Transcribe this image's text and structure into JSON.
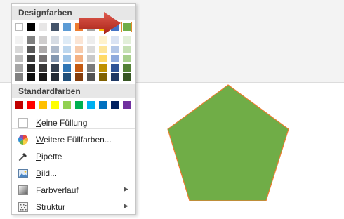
{
  "menu": {
    "design_header": "Designfarben",
    "standard_header": "Standardfarben",
    "items": [
      {
        "label": "Keine Füllung",
        "mnemonic": "K",
        "rest": "eine Füllung",
        "icon": "no-fill-swatch-icon"
      },
      {
        "label": "Weitere Füllfarben...",
        "mnemonic": "W",
        "rest": "eitere Füllfarben...",
        "icon": "color-wheel-icon"
      },
      {
        "label": "Pipette",
        "mnemonic": "P",
        "rest": "ipette",
        "icon": "eyedropper-icon"
      },
      {
        "label": "Bild...",
        "mnemonic": "B",
        "rest": "ild...",
        "icon": "picture-icon"
      },
      {
        "label": "Farbverlauf",
        "mnemonic": "F",
        "rest": "arbverlauf",
        "icon": "gradient-icon",
        "submenu": true
      },
      {
        "label": "Struktur",
        "mnemonic": "S",
        "rest": "truktur",
        "icon": "texture-icon",
        "submenu": true
      }
    ],
    "theme_colors": [
      "#ffffff",
      "#000000",
      "#e7e6e6",
      "#44546a",
      "#5b9bd5",
      "#ed7d31",
      "#a5a5a5",
      "#ffc000",
      "#4472c4",
      "#70ad47"
    ],
    "theme_shades": [
      [
        "#f2f2f2",
        "#d9d9d9",
        "#bfbfbf",
        "#a6a6a6",
        "#808080"
      ],
      [
        "#808080",
        "#595959",
        "#404040",
        "#262626",
        "#0d0d0d"
      ],
      [
        "#d0cece",
        "#aeabab",
        "#757171",
        "#3a3838",
        "#171616"
      ],
      [
        "#d6dce4",
        "#adb9ca",
        "#8497b0",
        "#333f4f",
        "#222a35"
      ],
      [
        "#deebf6",
        "#bdd7ee",
        "#9dc3e6",
        "#2e75b5",
        "#1f4e79"
      ],
      [
        "#fbe5d5",
        "#f7cbac",
        "#f4b183",
        "#c55a11",
        "#833c0b"
      ],
      [
        "#ededed",
        "#dbdbdb",
        "#c9c9c9",
        "#7b7b7b",
        "#525252"
      ],
      [
        "#fff2cc",
        "#fee599",
        "#ffd966",
        "#bf9000",
        "#7f6000"
      ],
      [
        "#dae3f3",
        "#b4c7e7",
        "#8faadc",
        "#2f5496",
        "#1f3864"
      ],
      [
        "#e2efd9",
        "#c5e0b3",
        "#a8d08d",
        "#538135",
        "#375623"
      ]
    ],
    "selected_theme_index": 9,
    "standard_colors": [
      "#c00000",
      "#ff0000",
      "#ffc000",
      "#ffff00",
      "#92d050",
      "#00b050",
      "#00b0f0",
      "#0070c0",
      "#002060",
      "#7030a0"
    ]
  },
  "canvas": {
    "shape": "pentagon",
    "fill_color": "#70ad47",
    "outline_color": "#ed7d31"
  },
  "pointer": {
    "icon": "red-arrow-icon",
    "color": "#c0392b"
  }
}
